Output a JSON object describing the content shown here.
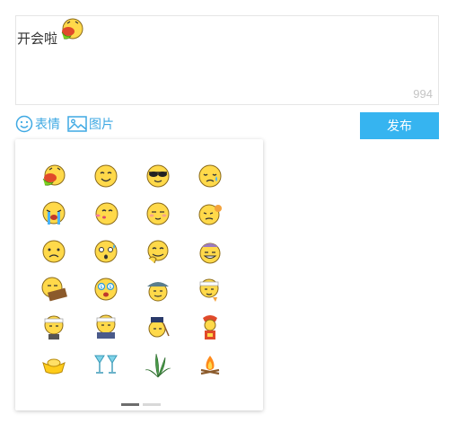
{
  "editor": {
    "text": "开会啦",
    "inline_emoji": "vomit",
    "char_count": "994"
  },
  "toolbar": {
    "emoji_label": "表情",
    "image_label": "图片",
    "publish_label": "发布"
  },
  "emoji_panel": {
    "items": [
      {
        "name": "vomit"
      },
      {
        "name": "smile"
      },
      {
        "name": "cool"
      },
      {
        "name": "tear"
      },
      {
        "name": "bawl"
      },
      {
        "name": "kiss"
      },
      {
        "name": "shy"
      },
      {
        "name": "grumpy"
      },
      {
        "name": "sad"
      },
      {
        "name": "scared"
      },
      {
        "name": "giggle"
      },
      {
        "name": "grin-hat"
      },
      {
        "name": "sign"
      },
      {
        "name": "money-eyes"
      },
      {
        "name": "beach-hat"
      },
      {
        "name": "headband"
      },
      {
        "name": "headband-guy"
      },
      {
        "name": "headband-laptop"
      },
      {
        "name": "scholar"
      },
      {
        "name": "god-of-wealth"
      },
      {
        "name": "gold-ingot"
      },
      {
        "name": "cheers"
      },
      {
        "name": "plant"
      },
      {
        "name": "campfire"
      }
    ],
    "pages": 2,
    "current_page": 1
  },
  "colors": {
    "accent": "#3fa9e3",
    "button": "#36b4f0",
    "face": "#ffd94a",
    "face_stroke": "#8a6a1a"
  }
}
